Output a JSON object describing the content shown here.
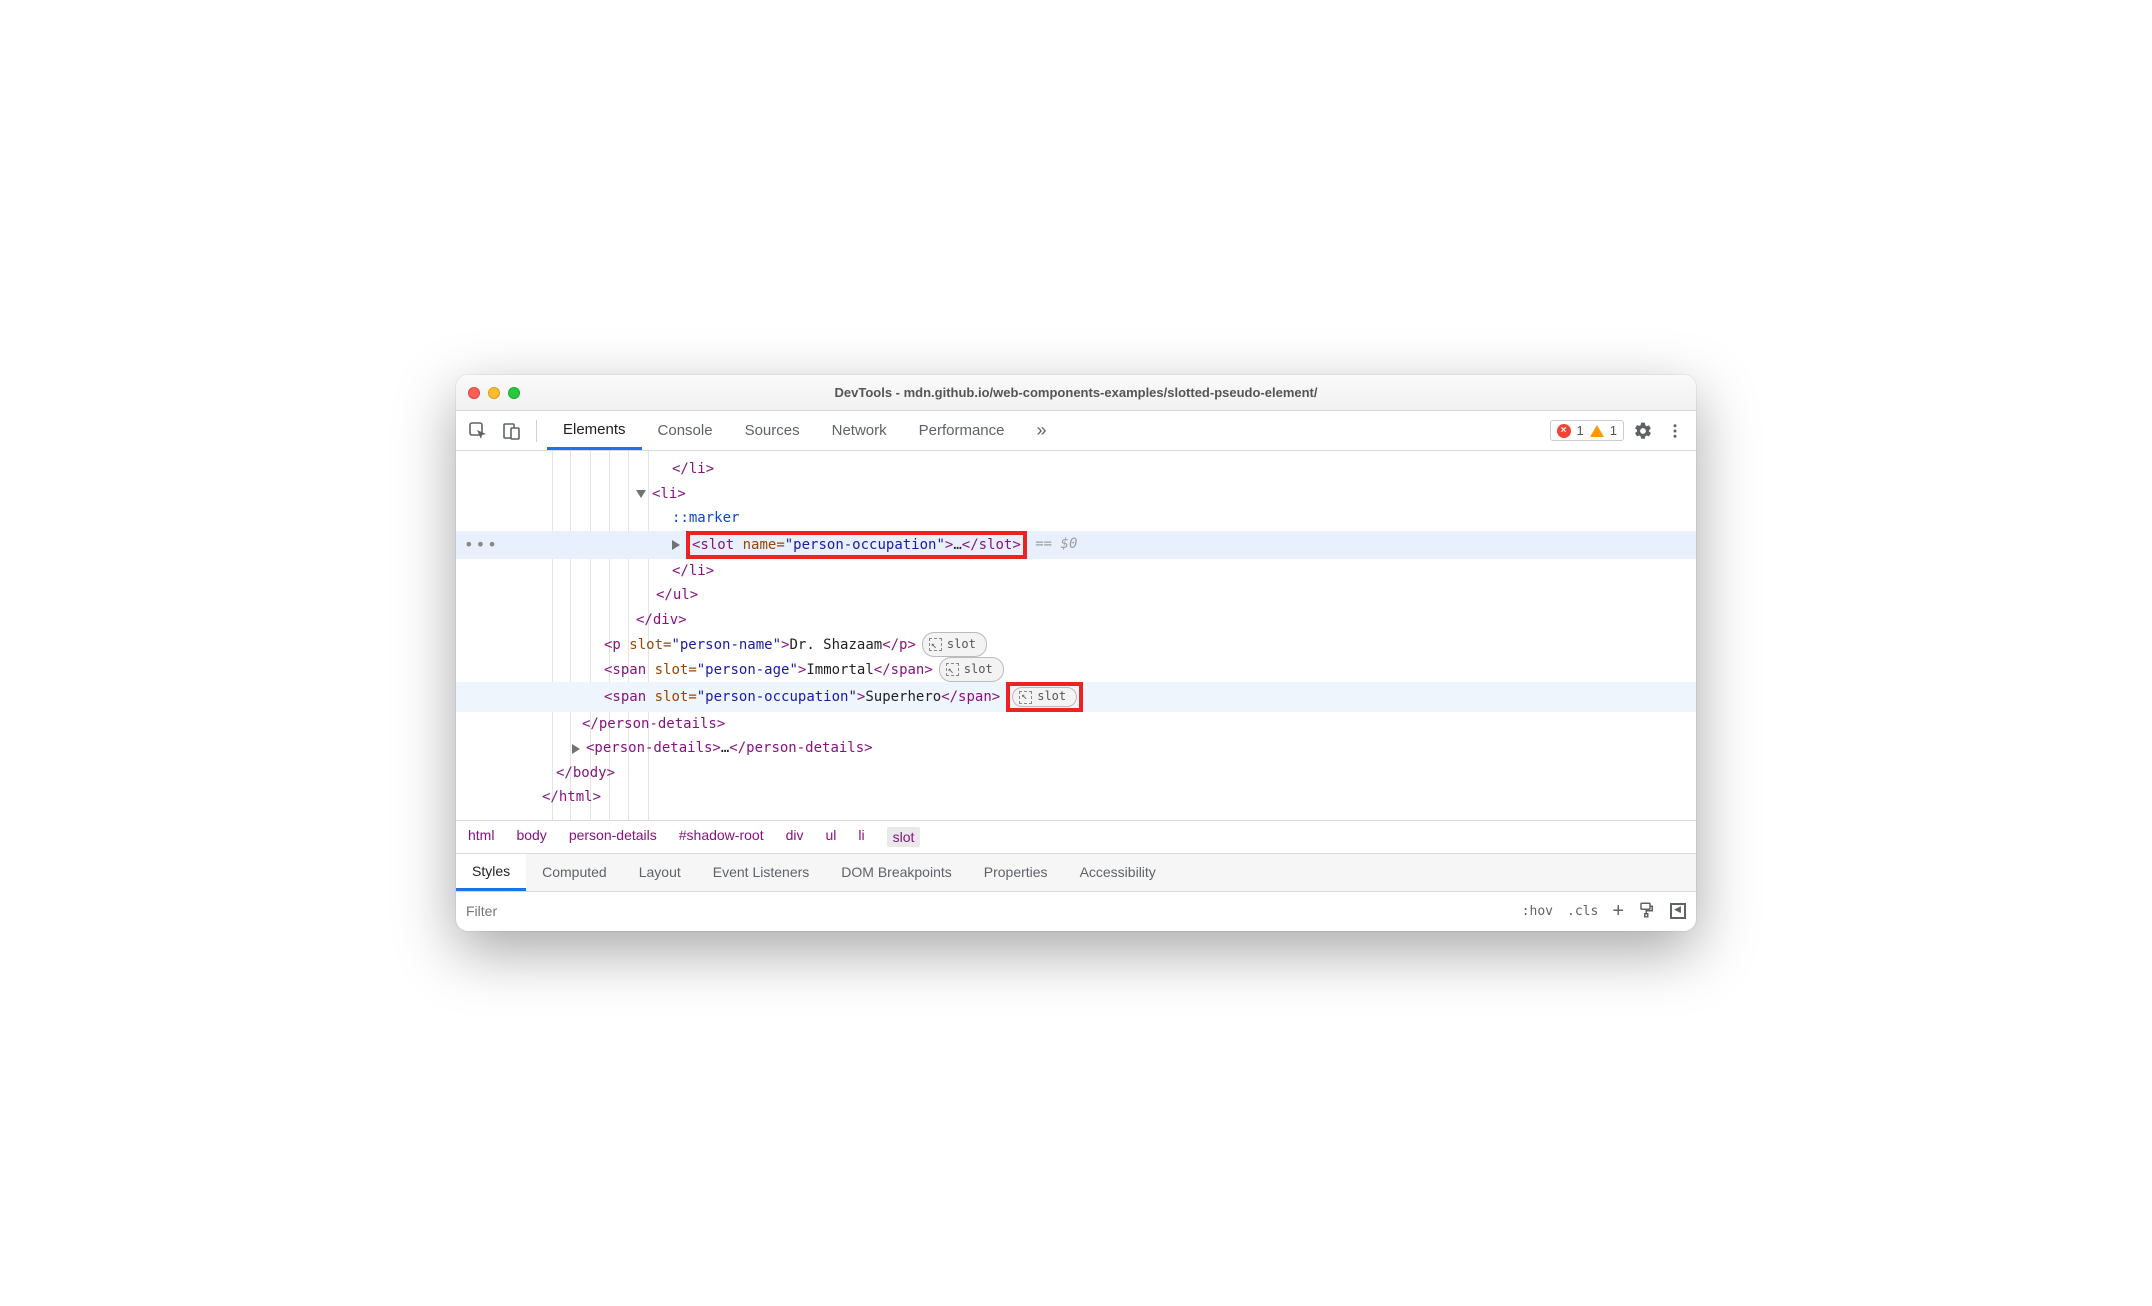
{
  "window": {
    "title": "DevTools - mdn.github.io/web-components-examples/slotted-pseudo-element/"
  },
  "toolbar": {
    "tabs": [
      "Elements",
      "Console",
      "Sources",
      "Network",
      "Performance"
    ],
    "errors": "1",
    "warnings": "1"
  },
  "dom": {
    "li_close1": "</li>",
    "li_open": "<li>",
    "marker": "::marker",
    "slot_open": "<slot",
    "slot_attr_name": "name",
    "slot_attr_val": "\"person-occupation\"",
    "slot_ellipsis": "…",
    "slot_close": "</slot>",
    "eq0": " == $0",
    "li_close2": "</li>",
    "ul_close": "</ul>",
    "div_close": "</div>",
    "p_open": "<p",
    "span_open": "<span",
    "slot_attr": "slot",
    "pname_v": "\"person-name\"",
    "pname_txt": "Dr. Shazaam",
    "p_close": "</p>",
    "page_v": "\"person-age\"",
    "page_txt": "Immortal",
    "span_close": "</span>",
    "pocc_v": "\"person-occupation\"",
    "pocc_txt": "Superhero",
    "pd_close": "</person-details>",
    "pd_open": "<person-details>",
    "pd_ell": "…",
    "body_close": "</body>",
    "html_close": "</html>",
    "slot_badge": "slot"
  },
  "breadcrumbs": [
    "html",
    "body",
    "person-details",
    "#shadow-root",
    "div",
    "ul",
    "li",
    "slot"
  ],
  "subtabs": [
    "Styles",
    "Computed",
    "Layout",
    "Event Listeners",
    "DOM Breakpoints",
    "Properties",
    "Accessibility"
  ],
  "styles": {
    "filter_placeholder": "Filter",
    "hov": ":hov",
    "cls": ".cls"
  }
}
